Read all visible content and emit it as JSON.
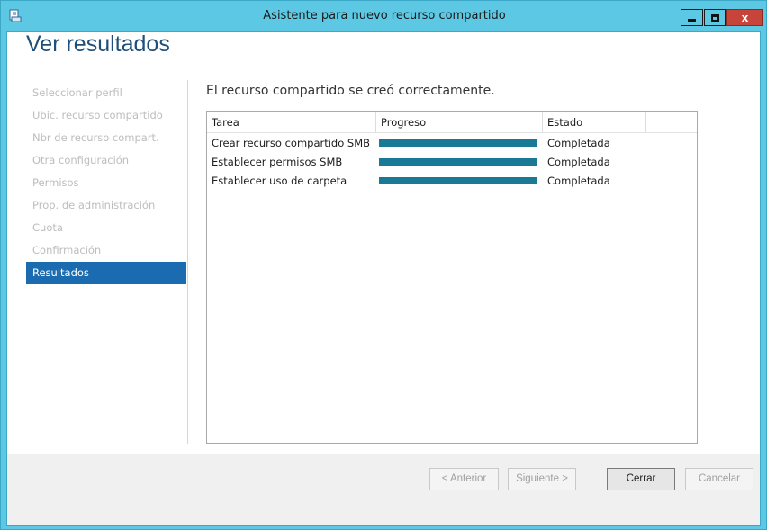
{
  "window": {
    "title": "Asistente para nuevo recurso compartido",
    "controls": {
      "minimize": "",
      "maximize": "",
      "close": "x"
    },
    "accent": "#5cc8e4"
  },
  "page": {
    "title": "Ver resultados",
    "status_message": "El recurso compartido se creó correctamente."
  },
  "nav": {
    "items": [
      {
        "label": "Seleccionar perfil"
      },
      {
        "label": "Ubic. recurso compartido"
      },
      {
        "label": "Nbr de recurso compart."
      },
      {
        "label": "Otra configuración"
      },
      {
        "label": "Permisos"
      },
      {
        "label": "Prop. de administración"
      },
      {
        "label": "Cuota"
      },
      {
        "label": "Confirmación"
      },
      {
        "label": "Resultados"
      }
    ],
    "active_index": 8,
    "active_color": "#1a6bb0"
  },
  "results": {
    "columns": {
      "task": "Tarea",
      "progress": "Progreso",
      "state": "Estado"
    },
    "rows": [
      {
        "task": "Crear recurso compartido SMB",
        "progress": 1.0,
        "state": "Completada"
      },
      {
        "task": "Establecer permisos SMB",
        "progress": 1.0,
        "state": "Completada"
      },
      {
        "task": "Establecer uso de carpeta",
        "progress": 1.0,
        "state": "Completada"
      }
    ],
    "bar_color": "#1a7a96"
  },
  "buttons": {
    "back": "< Anterior",
    "next": "Siguiente >",
    "close": "Cerrar",
    "cancel": "Cancelar"
  }
}
